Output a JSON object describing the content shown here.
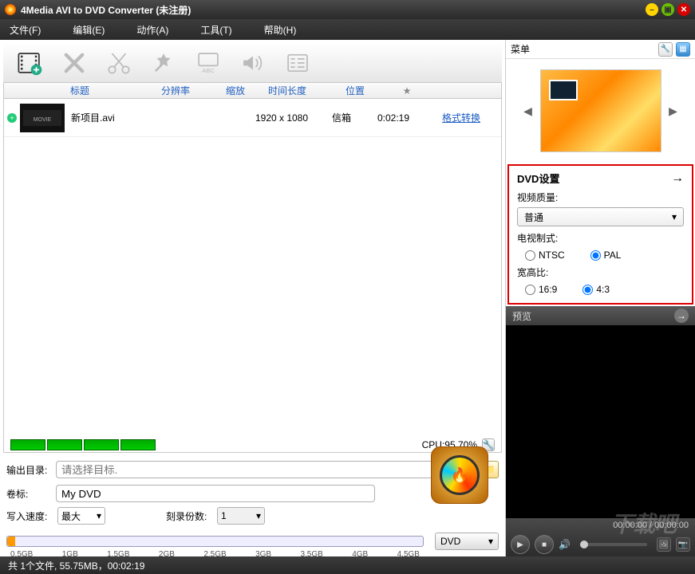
{
  "window": {
    "title": "4Media AVI to DVD Converter (未注册)"
  },
  "menu": {
    "file": "文件(F)",
    "edit": "编辑(E)",
    "action": "动作(A)",
    "tools": "工具(T)",
    "help": "帮助(H)"
  },
  "columns": {
    "title": "标题",
    "resolution": "分辨率",
    "zoom": "缩放",
    "duration": "时间长度",
    "position": "位置",
    "star": "★"
  },
  "rows": [
    {
      "filename": "新项目.avi",
      "resolution": "1920 x 1080",
      "zoom": "信箱",
      "duration": "0:02:19",
      "format_link": "格式转换"
    }
  ],
  "cpu": {
    "label": "CPU:95.70%"
  },
  "form": {
    "output_label": "输出目录:",
    "output_placeholder": "请选择目标.",
    "volume_label": "卷标:",
    "volume_value": "My DVD",
    "speed_label": "写入速度:",
    "speed_value": "最大",
    "copies_label": "刻录份数:",
    "copies_value": "1"
  },
  "scale": {
    "ticks": [
      "0.5GB",
      "1GB",
      "1.5GB",
      "2GB",
      "2.5GB",
      "3GB",
      "3.5GB",
      "4GB",
      "4.5GB"
    ],
    "target": "DVD"
  },
  "right": {
    "menu_label": "菜单",
    "dvd_settings": "DVD设置",
    "video_quality_label": "视频质量:",
    "video_quality_value": "普通",
    "tv_mode_label": "电视制式:",
    "tv_ntsc": "NTSC",
    "tv_pal": "PAL",
    "tv_selected": "PAL",
    "aspect_label": "宽高比:",
    "aspect_169": "16:9",
    "aspect_43": "4:3",
    "aspect_selected": "4:3",
    "preview_label": "预览",
    "timecode": "00:00:00 / 00:00:00"
  },
  "status": {
    "text": "共 1个文件, 55.75MB，00:02:19"
  },
  "watermark": "下载吧"
}
